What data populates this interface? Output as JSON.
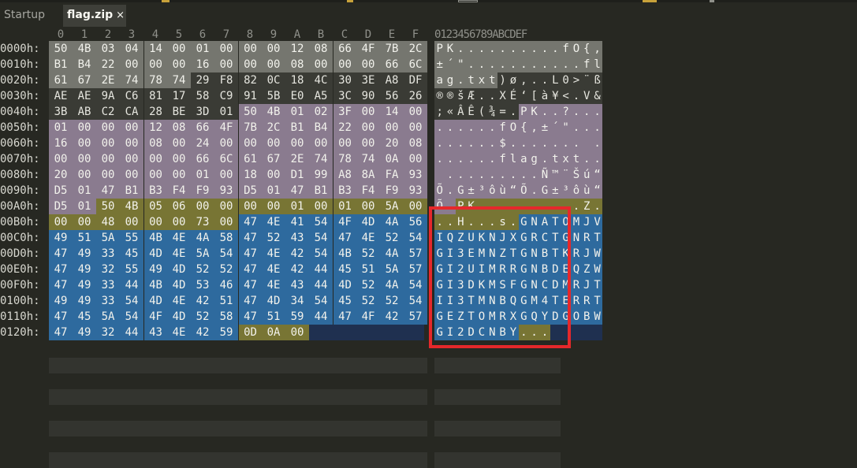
{
  "tabs": [
    {
      "label": "Startup",
      "active": false
    },
    {
      "label": "flag.zip",
      "active": true,
      "close_glyph": "×"
    }
  ],
  "hex_view": {
    "column_labels": [
      "0",
      "1",
      "2",
      "3",
      "4",
      "5",
      "6",
      "7",
      "8",
      "9",
      "A",
      "B",
      "C",
      "D",
      "E",
      "F"
    ],
    "ascii_header": "0123456789ABCDEF",
    "rows": [
      {
        "offset": "0000h:",
        "bytes": [
          "50",
          "4B",
          "03",
          "04",
          "14",
          "00",
          "01",
          "00",
          "00",
          "00",
          "12",
          "08",
          "66",
          "4F",
          "7B",
          "2C"
        ],
        "ascii": "PK..........fO{,",
        "colors": [
          "g",
          "g",
          "g",
          "g",
          "g",
          "g",
          "g",
          "g",
          "g",
          "g",
          "g",
          "g",
          "g",
          "g",
          "g",
          "g"
        ]
      },
      {
        "offset": "0010h:",
        "bytes": [
          "B1",
          "B4",
          "22",
          "00",
          "00",
          "00",
          "16",
          "00",
          "00",
          "00",
          "08",
          "00",
          "00",
          "00",
          "66",
          "6C"
        ],
        "ascii": "±´\"...........fl",
        "colors": [
          "g",
          "g",
          "g",
          "g",
          "g",
          "g",
          "g",
          "g",
          "g",
          "g",
          "g",
          "g",
          "g",
          "g",
          "g",
          "g"
        ]
      },
      {
        "offset": "0020h:",
        "bytes": [
          "61",
          "67",
          "2E",
          "74",
          "78",
          "74",
          "29",
          "F8",
          "82",
          "0C",
          "18",
          "4C",
          "30",
          "3E",
          "A8",
          "DF"
        ],
        "ascii": "ag.txt)ø‚..L0>¨ß",
        "colors": [
          "g",
          "g",
          "g",
          "g",
          "g",
          "g",
          "n",
          "n",
          "n",
          "n",
          "n",
          "n",
          "n",
          "n",
          "n",
          "n"
        ]
      },
      {
        "offset": "0030h:",
        "bytes": [
          "AE",
          "AE",
          "9A",
          "C6",
          "81",
          "17",
          "58",
          "C9",
          "91",
          "5B",
          "E0",
          "A5",
          "3C",
          "90",
          "56",
          "26"
        ],
        "ascii": "®®šÆ..XÉ‘[à¥<.V&",
        "colors": [
          "n",
          "n",
          "n",
          "n",
          "n",
          "n",
          "n",
          "n",
          "n",
          "n",
          "n",
          "n",
          "n",
          "n",
          "n",
          "n"
        ]
      },
      {
        "offset": "0040h:",
        "bytes": [
          "3B",
          "AB",
          "C2",
          "CA",
          "28",
          "BE",
          "3D",
          "01",
          "50",
          "4B",
          "01",
          "02",
          "3F",
          "00",
          "14",
          "00"
        ],
        "ascii": ";«ÂÊ(¾=.PK..?...",
        "colors": [
          "n",
          "n",
          "n",
          "n",
          "n",
          "n",
          "n",
          "n",
          "p",
          "p",
          "p",
          "p",
          "p",
          "p",
          "p",
          "p"
        ]
      },
      {
        "offset": "0050h:",
        "bytes": [
          "01",
          "00",
          "00",
          "00",
          "12",
          "08",
          "66",
          "4F",
          "7B",
          "2C",
          "B1",
          "B4",
          "22",
          "00",
          "00",
          "00"
        ],
        "ascii": "......fO{,±´\"...",
        "colors": [
          "p",
          "p",
          "p",
          "p",
          "p",
          "p",
          "p",
          "p",
          "p",
          "p",
          "p",
          "p",
          "p",
          "p",
          "p",
          "p"
        ]
      },
      {
        "offset": "0060h:",
        "bytes": [
          "16",
          "00",
          "00",
          "00",
          "08",
          "00",
          "24",
          "00",
          "00",
          "00",
          "00",
          "00",
          "00",
          "00",
          "20",
          "08"
        ],
        "ascii": "......$....... .",
        "colors": [
          "p",
          "p",
          "p",
          "p",
          "p",
          "p",
          "p",
          "p",
          "p",
          "p",
          "p",
          "p",
          "p",
          "p",
          "p",
          "p"
        ]
      },
      {
        "offset": "0070h:",
        "bytes": [
          "00",
          "00",
          "00",
          "00",
          "00",
          "00",
          "66",
          "6C",
          "61",
          "67",
          "2E",
          "74",
          "78",
          "74",
          "0A",
          "00"
        ],
        "ascii": "......flag.txt..",
        "colors": [
          "p",
          "p",
          "p",
          "p",
          "p",
          "p",
          "p",
          "p",
          "p",
          "p",
          "p",
          "p",
          "p",
          "p",
          "p",
          "p"
        ]
      },
      {
        "offset": "0080h:",
        "bytes": [
          "20",
          "00",
          "00",
          "00",
          "00",
          "00",
          "01",
          "00",
          "18",
          "00",
          "D1",
          "99",
          "A8",
          "8A",
          "FA",
          "93"
        ],
        "ascii": " .........Ñ™¨Šú“",
        "colors": [
          "p",
          "p",
          "p",
          "p",
          "p",
          "p",
          "p",
          "p",
          "p",
          "p",
          "p",
          "p",
          "p",
          "p",
          "p",
          "p"
        ]
      },
      {
        "offset": "0090h:",
        "bytes": [
          "D5",
          "01",
          "47",
          "B1",
          "B3",
          "F4",
          "F9",
          "93",
          "D5",
          "01",
          "47",
          "B1",
          "B3",
          "F4",
          "F9",
          "93"
        ],
        "ascii": "Õ.G±³ôù“Õ.G±³ôù“",
        "colors": [
          "p",
          "p",
          "p",
          "p",
          "p",
          "p",
          "p",
          "p",
          "p",
          "p",
          "p",
          "p",
          "p",
          "p",
          "p",
          "p"
        ]
      },
      {
        "offset": "00A0h:",
        "bytes": [
          "D5",
          "01",
          "50",
          "4B",
          "05",
          "06",
          "00",
          "00",
          "00",
          "00",
          "01",
          "00",
          "01",
          "00",
          "5A",
          "00"
        ],
        "ascii": "Õ.PK..........Z.",
        "colors": [
          "p",
          "p",
          "o",
          "o",
          "o",
          "o",
          "o",
          "o",
          "o",
          "o",
          "o",
          "o",
          "o",
          "o",
          "o",
          "o"
        ]
      },
      {
        "offset": "00B0h:",
        "bytes": [
          "00",
          "00",
          "48",
          "00",
          "00",
          "00",
          "73",
          "00",
          "47",
          "4E",
          "41",
          "54",
          "4F",
          "4D",
          "4A",
          "56"
        ],
        "ascii": "..H...s.GNATOMJV",
        "colors": [
          "o",
          "o",
          "o",
          "o",
          "o",
          "o",
          "o",
          "o",
          "b",
          "b",
          "b",
          "b",
          "b",
          "b",
          "b",
          "b"
        ]
      },
      {
        "offset": "00C0h:",
        "bytes": [
          "49",
          "51",
          "5A",
          "55",
          "4B",
          "4E",
          "4A",
          "58",
          "47",
          "52",
          "43",
          "54",
          "47",
          "4E",
          "52",
          "54"
        ],
        "ascii": "IQZUKNJXGRCTGNRT",
        "colors": [
          "b",
          "b",
          "b",
          "b",
          "b",
          "b",
          "b",
          "b",
          "b",
          "b",
          "b",
          "b",
          "b",
          "b",
          "b",
          "b"
        ]
      },
      {
        "offset": "00D0h:",
        "bytes": [
          "47",
          "49",
          "33",
          "45",
          "4D",
          "4E",
          "5A",
          "54",
          "47",
          "4E",
          "42",
          "54",
          "4B",
          "52",
          "4A",
          "57"
        ],
        "ascii": "GI3EMNZTGNBTKRJW",
        "colors": [
          "b",
          "b",
          "b",
          "b",
          "b",
          "b",
          "b",
          "b",
          "b",
          "b",
          "b",
          "b",
          "b",
          "b",
          "b",
          "b"
        ]
      },
      {
        "offset": "00E0h:",
        "bytes": [
          "47",
          "49",
          "32",
          "55",
          "49",
          "4D",
          "52",
          "52",
          "47",
          "4E",
          "42",
          "44",
          "45",
          "51",
          "5A",
          "57"
        ],
        "ascii": "GI2UIMRRGNBDEQZW",
        "colors": [
          "b",
          "b",
          "b",
          "b",
          "b",
          "b",
          "b",
          "b",
          "b",
          "b",
          "b",
          "b",
          "b",
          "b",
          "b",
          "b"
        ]
      },
      {
        "offset": "00F0h:",
        "bytes": [
          "47",
          "49",
          "33",
          "44",
          "4B",
          "4D",
          "53",
          "46",
          "47",
          "4E",
          "43",
          "44",
          "4D",
          "52",
          "4A",
          "54"
        ],
        "ascii": "GI3DKMSFGNCDMRJT",
        "colors": [
          "b",
          "b",
          "b",
          "b",
          "b",
          "b",
          "b",
          "b",
          "b",
          "b",
          "b",
          "b",
          "b",
          "b",
          "b",
          "b"
        ]
      },
      {
        "offset": "0100h:",
        "bytes": [
          "49",
          "49",
          "33",
          "54",
          "4D",
          "4E",
          "42",
          "51",
          "47",
          "4D",
          "34",
          "54",
          "45",
          "52",
          "52",
          "54"
        ],
        "ascii": "II3TMNBQGM4TERRT",
        "colors": [
          "b",
          "b",
          "b",
          "b",
          "b",
          "b",
          "b",
          "b",
          "b",
          "b",
          "b",
          "b",
          "b",
          "b",
          "b",
          "b"
        ]
      },
      {
        "offset": "0110h:",
        "bytes": [
          "47",
          "45",
          "5A",
          "54",
          "4F",
          "4D",
          "52",
          "58",
          "47",
          "51",
          "59",
          "44",
          "47",
          "4F",
          "42",
          "57"
        ],
        "ascii": "GEZTOMRXGQYDGOBW",
        "colors": [
          "b",
          "b",
          "b",
          "b",
          "b",
          "b",
          "b",
          "b",
          "b",
          "b",
          "b",
          "b",
          "b",
          "b",
          "b",
          "b"
        ]
      },
      {
        "offset": "0120h:",
        "bytes": [
          "47",
          "49",
          "32",
          "44",
          "43",
          "4E",
          "42",
          "59",
          "0D",
          "0A",
          "00"
        ],
        "ascii": "GI2DCNBY...",
        "colors": [
          "b",
          "b",
          "b",
          "b",
          "b",
          "b",
          "b",
          "b",
          "o",
          "o",
          "o"
        ]
      }
    ]
  },
  "colors": {
    "background": "#272822",
    "header_zip": "#75766f",
    "data_plain": "#3a3b35",
    "central_dir": "#8a7b8f",
    "end_record": "#787534",
    "text_payload": "#2e6a9e",
    "highlight_box": "#e5282b",
    "top_marks": [
      "#c7a13a",
      "#c7a13a",
      "#8f908a"
    ]
  }
}
